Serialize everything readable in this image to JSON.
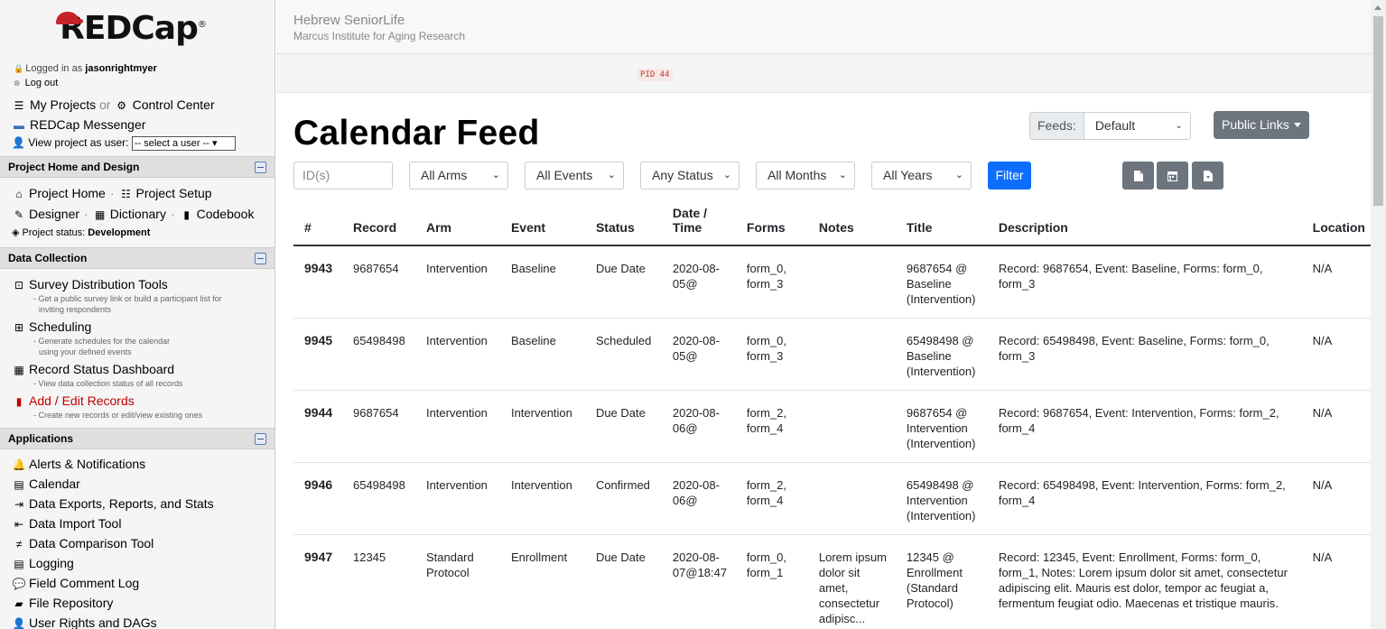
{
  "sidebar": {
    "logo_text": "REDCap",
    "logo_reg": "®",
    "logged_in_prefix": "Logged in as",
    "username": "jasonrightmyer",
    "logout": "Log out",
    "my_projects": "My Projects",
    "or": "or",
    "control_center": "Control Center",
    "messenger": "REDCap Messenger",
    "view_as_label": "View project as user:",
    "view_as_value": "-- select a user --",
    "sections": {
      "home_design": "Project Home and Design",
      "data_collection": "Data Collection",
      "applications": "Applications"
    },
    "project_home": "Project Home",
    "project_setup": "Project Setup",
    "designer": "Designer",
    "dictionary": "Dictionary",
    "codebook": "Codebook",
    "project_status_label": "Project status:",
    "project_status_value": "Development",
    "tools": [
      {
        "label": "Survey Distribution Tools",
        "desc1": "- Get a public survey link or build a participant list for",
        "desc2": "inviting respondents"
      },
      {
        "label": "Scheduling",
        "desc1": "- Generate schedules for the calendar",
        "desc2": "using your defined events"
      },
      {
        "label": "Record Status Dashboard",
        "desc1": "- View data collection status of all records",
        "desc2": ""
      },
      {
        "label": "Add / Edit Records",
        "desc1": "- Create new records or edit/view existing ones",
        "desc2": ""
      }
    ],
    "apps": [
      "Alerts & Notifications",
      "Calendar",
      "Data Exports, Reports, and Stats",
      "Data Import Tool",
      "Data Comparison Tool",
      "Logging",
      "Field Comment Log",
      "File Repository",
      "User Rights and DAGs"
    ]
  },
  "header": {
    "institution": "Hebrew SeniorLife",
    "department": "Marcus Institute for Aging Research",
    "pid": "PID 44"
  },
  "page": {
    "title": "Calendar Feed",
    "feeds_label": "Feeds:",
    "feeds_value": "Default",
    "public_links": "Public Links"
  },
  "filters": {
    "ids_placeholder": "ID(s)",
    "arms": "All Arms",
    "events": "All Events",
    "status": "Any Status",
    "months": "All Months",
    "years": "All Years",
    "filter_button": "Filter"
  },
  "table": {
    "headers": [
      "#",
      "Record",
      "Arm",
      "Event",
      "Status",
      "Date / Time",
      "Forms",
      "Notes",
      "Title",
      "Description",
      "Location"
    ],
    "rows": [
      {
        "num": "9943",
        "record": "9687654",
        "arm": "Intervention",
        "event": "Baseline",
        "status": "Due Date",
        "datetime": "2020-08-05@",
        "forms": "form_0, form_3",
        "notes": "",
        "title": "9687654 @ Baseline (Intervention)",
        "description": "Record: 9687654, Event: Baseline, Forms: form_0, form_3",
        "location": "N/A"
      },
      {
        "num": "9945",
        "record": "65498498",
        "arm": "Intervention",
        "event": "Baseline",
        "status": "Scheduled",
        "datetime": "2020-08-05@",
        "forms": "form_0, form_3",
        "notes": "",
        "title": "65498498 @ Baseline (Intervention)",
        "description": "Record: 65498498, Event: Baseline, Forms: form_0, form_3",
        "location": "N/A"
      },
      {
        "num": "9944",
        "record": "9687654",
        "arm": "Intervention",
        "event": "Intervention",
        "status": "Due Date",
        "datetime": "2020-08-06@",
        "forms": "form_2, form_4",
        "notes": "",
        "title": "9687654 @ Intervention (Intervention)",
        "description": "Record: 9687654, Event: Intervention, Forms: form_2, form_4",
        "location": "N/A"
      },
      {
        "num": "9946",
        "record": "65498498",
        "arm": "Intervention",
        "event": "Intervention",
        "status": "Confirmed",
        "datetime": "2020-08-06@",
        "forms": "form_2, form_4",
        "notes": "",
        "title": "65498498 @ Intervention (Intervention)",
        "description": "Record: 65498498, Event: Intervention, Forms: form_2, form_4",
        "location": "N/A"
      },
      {
        "num": "9947",
        "record": "12345",
        "arm": "Standard Protocol",
        "event": "Enrollment",
        "status": "Due Date",
        "datetime": "2020-08-07@18:47",
        "forms": "form_0, form_1",
        "notes": "Lorem ipsum dolor sit amet, consectetur adipisc...",
        "title": "12345 @ Enrollment (Standard Protocol)",
        "description": "Record: 12345, Event: Enrollment, Forms: form_0, form_1, Notes: Lorem ipsum dolor sit amet, consectetur adipiscing elit. Mauris est dolor, tempor ac feugiat a, fermentum feugiat odio. Maecenas et tristique mauris.",
        "location": "N/A"
      }
    ]
  },
  "colors": {
    "filter_blue": "#0d6efd",
    "secondary_gray": "#6c757d",
    "pid_red": "#c0392b",
    "records_red": "#c00000"
  }
}
